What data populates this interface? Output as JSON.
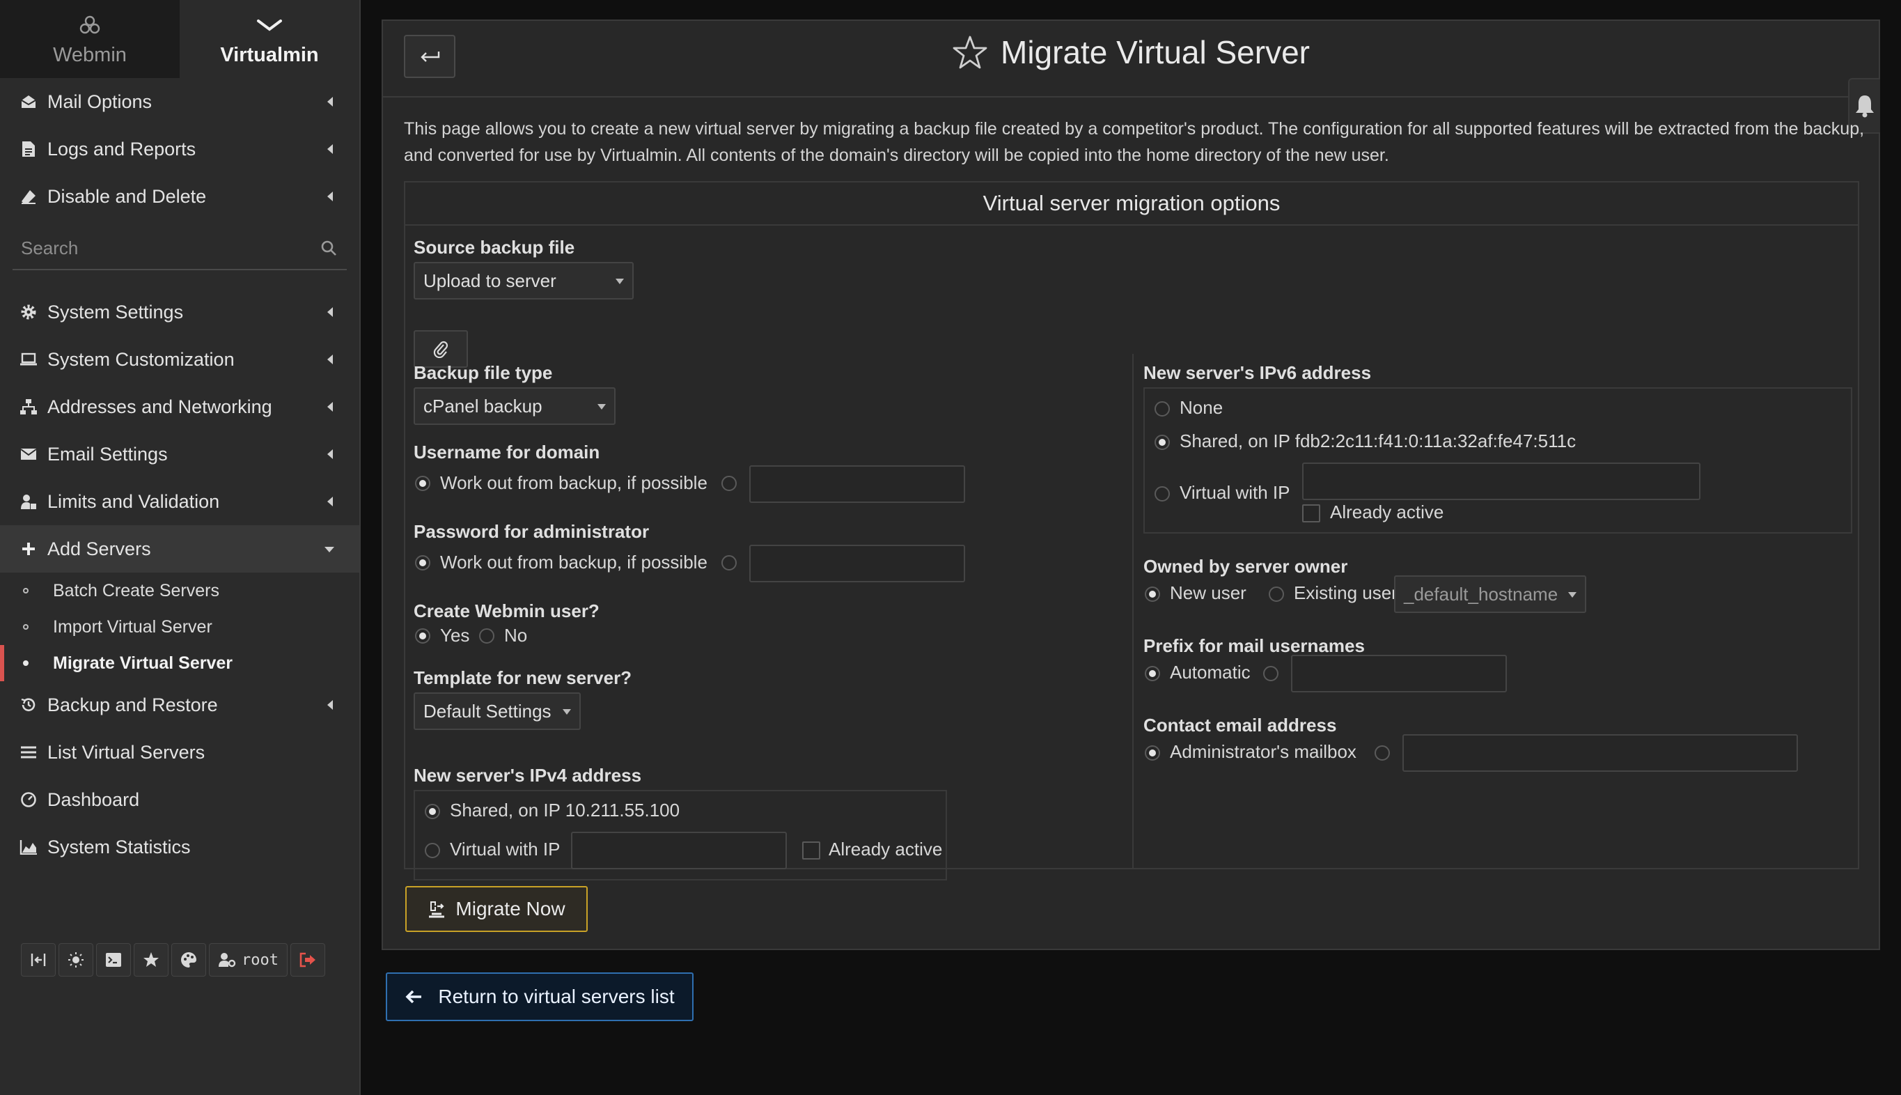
{
  "sidebar": {
    "tabs": [
      {
        "label": "Webmin",
        "icon": "webmin-logo-icon"
      },
      {
        "label": "Virtualmin",
        "icon": "chevron-down-icon"
      }
    ],
    "menu_top": [
      {
        "label": "Mail Options",
        "icon": "envelope-open-icon"
      },
      {
        "label": "Logs and Reports",
        "icon": "file-text-icon"
      },
      {
        "label": "Disable and Delete",
        "icon": "eraser-icon"
      }
    ],
    "search_placeholder": "Search",
    "menu_main": [
      {
        "label": "System Settings",
        "icon": "gear-icon"
      },
      {
        "label": "System Customization",
        "icon": "laptop-icon"
      },
      {
        "label": "Addresses and Networking",
        "icon": "network-icon"
      },
      {
        "label": "Email Settings",
        "icon": "envelope-icon"
      },
      {
        "label": "Limits and Validation",
        "icon": "user-lock-icon"
      },
      {
        "label": "Add Servers",
        "icon": "plus-icon"
      }
    ],
    "submenu": [
      {
        "label": "Batch Create Servers"
      },
      {
        "label": "Import Virtual Server"
      },
      {
        "label": "Migrate Virtual Server"
      }
    ],
    "menu_bottom": [
      {
        "label": "Backup and Restore",
        "icon": "history-icon"
      },
      {
        "label": "List Virtual Servers",
        "icon": "list-icon"
      },
      {
        "label": "Dashboard",
        "icon": "dashboard-icon"
      },
      {
        "label": "System Statistics",
        "icon": "area-chart-icon"
      }
    ],
    "footer": {
      "user": "root"
    }
  },
  "page": {
    "title": "Migrate Virtual Server",
    "intro": "This page allows you to create a new virtual server by migrating a backup file created by a competitor's product. The configuration for all supported features will be extracted from the backup, and converted for use by Virtualmin. All contents of the domain's directory will be copied into the home directory of the new user.",
    "section_title": "Virtual server migration options"
  },
  "form": {
    "source_backup": {
      "label": "Source backup file",
      "value": "Upload to server"
    },
    "backup_type": {
      "label": "Backup file type",
      "value": "cPanel backup"
    },
    "username": {
      "label": "Username for domain",
      "option": "Work out from backup, if possible"
    },
    "password": {
      "label": "Password for administrator",
      "option": "Work out from backup, if possible"
    },
    "webmin_user": {
      "label": "Create Webmin user?",
      "yes": "Yes",
      "no": "No"
    },
    "template": {
      "label": "Template for new server?",
      "value": "Default Settings"
    },
    "ipv4": {
      "label": "New server's IPv4 address",
      "shared": "Shared, on IP 10.211.55.100",
      "virtual": "Virtual with IP",
      "already_active": "Already active"
    },
    "ipv6": {
      "label": "New server's IPv6 address",
      "none": "None",
      "shared": "Shared, on IP fdb2:2c11:f41:0:11a:32af:fe47:511c",
      "virtual": "Virtual with IP",
      "already_active": "Already active"
    },
    "owner": {
      "label": "Owned by server owner",
      "new_user": "New user",
      "existing_user": "Existing user",
      "select_value": "_default_hostname"
    },
    "mail_prefix": {
      "label": "Prefix for mail usernames",
      "option": "Automatic"
    },
    "contact_email": {
      "label": "Contact email address",
      "option": "Administrator's mailbox"
    }
  },
  "buttons": {
    "migrate": "Migrate Now",
    "return": "Return to virtual servers list"
  }
}
